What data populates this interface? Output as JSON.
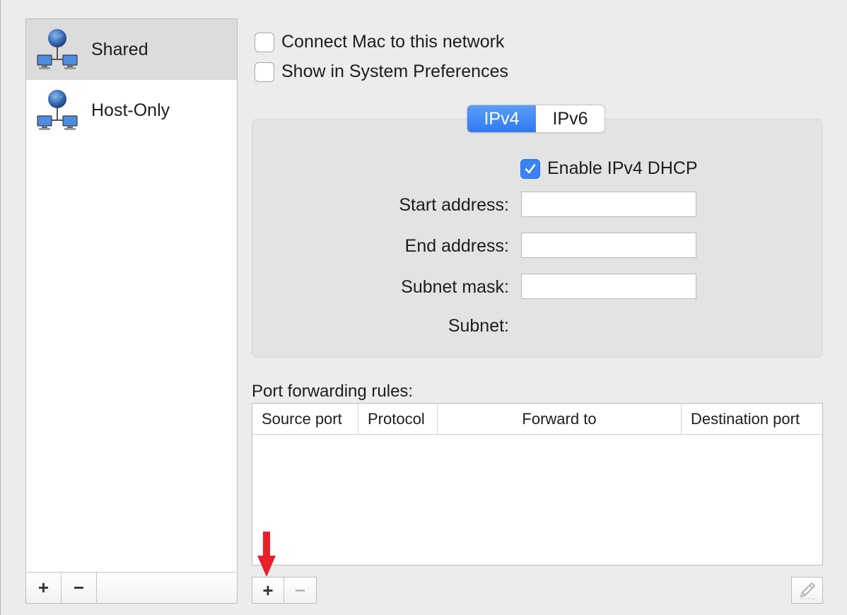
{
  "sidebar": {
    "items": [
      {
        "label": "Shared",
        "selected": true,
        "icon": "network-globe-icon"
      },
      {
        "label": "Host-Only",
        "selected": false,
        "icon": "network-globe-icon"
      }
    ],
    "add_label": "+",
    "remove_label": "−"
  },
  "options": {
    "connect_mac": {
      "label": "Connect Mac to this network",
      "checked": false
    },
    "show_in_prefs": {
      "label": "Show in System Preferences",
      "checked": false
    }
  },
  "tabs": [
    {
      "label": "IPv4",
      "active": true
    },
    {
      "label": "IPv6",
      "active": false
    }
  ],
  "ipv4": {
    "dhcp": {
      "label": "Enable IPv4 DHCP",
      "checked": true
    },
    "start_address": {
      "label": "Start address:",
      "value": ""
    },
    "end_address": {
      "label": "End address:",
      "value": ""
    },
    "subnet_mask": {
      "label": "Subnet mask:",
      "value": ""
    },
    "subnet": {
      "label": "Subnet:",
      "value": ""
    }
  },
  "port_forwarding": {
    "title": "Port forwarding rules:",
    "columns": [
      "Source port",
      "Protocol",
      "Forward to",
      "Destination port"
    ],
    "rows": [],
    "add_label": "+",
    "remove_label": "−",
    "edit_icon": "pencil-icon"
  },
  "colors": {
    "accent": "#2f7af1",
    "annotation_arrow": "#e8202a"
  }
}
